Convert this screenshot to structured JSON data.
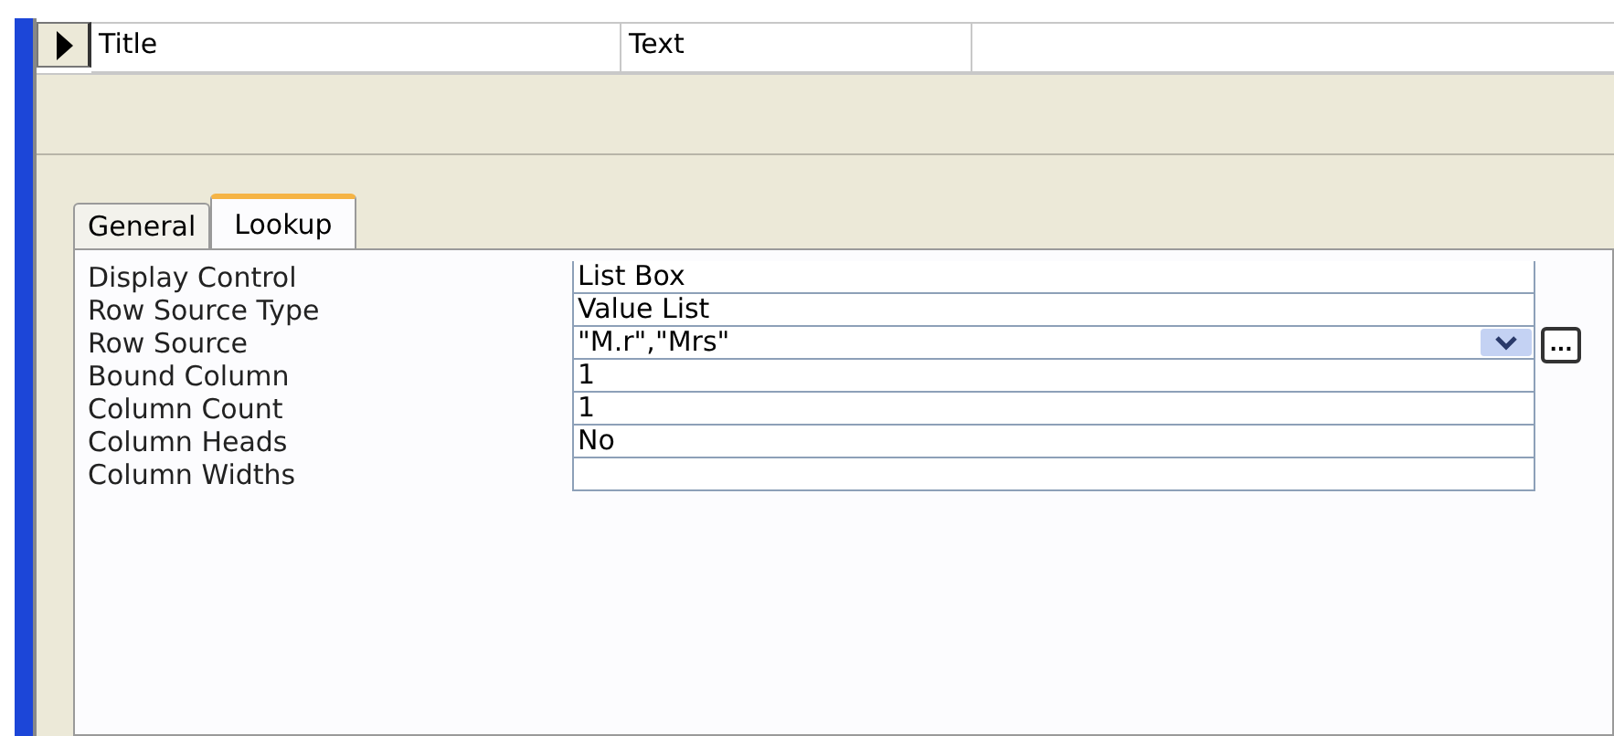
{
  "field_row": {
    "selected": true,
    "name": "Title",
    "data_type": "Text"
  },
  "tabs": [
    {
      "label": "General",
      "selected": false
    },
    {
      "label": "Lookup",
      "selected": true
    }
  ],
  "properties": [
    {
      "name": "Display Control",
      "value": "List Box",
      "kind": "plain"
    },
    {
      "name": "Row Source Type",
      "value": "Value List",
      "kind": "plain"
    },
    {
      "name": "Row Source",
      "value": "\"M.r\",\"Mrs\"",
      "kind": "combo",
      "builder": "..."
    },
    {
      "name": "Bound Column",
      "value": "1",
      "kind": "plain"
    },
    {
      "name": "Column Count",
      "value": "1",
      "kind": "plain"
    },
    {
      "name": "Column Heads",
      "value": "No",
      "kind": "plain"
    },
    {
      "name": "Column Widths",
      "kind": "plain"
    }
  ]
}
